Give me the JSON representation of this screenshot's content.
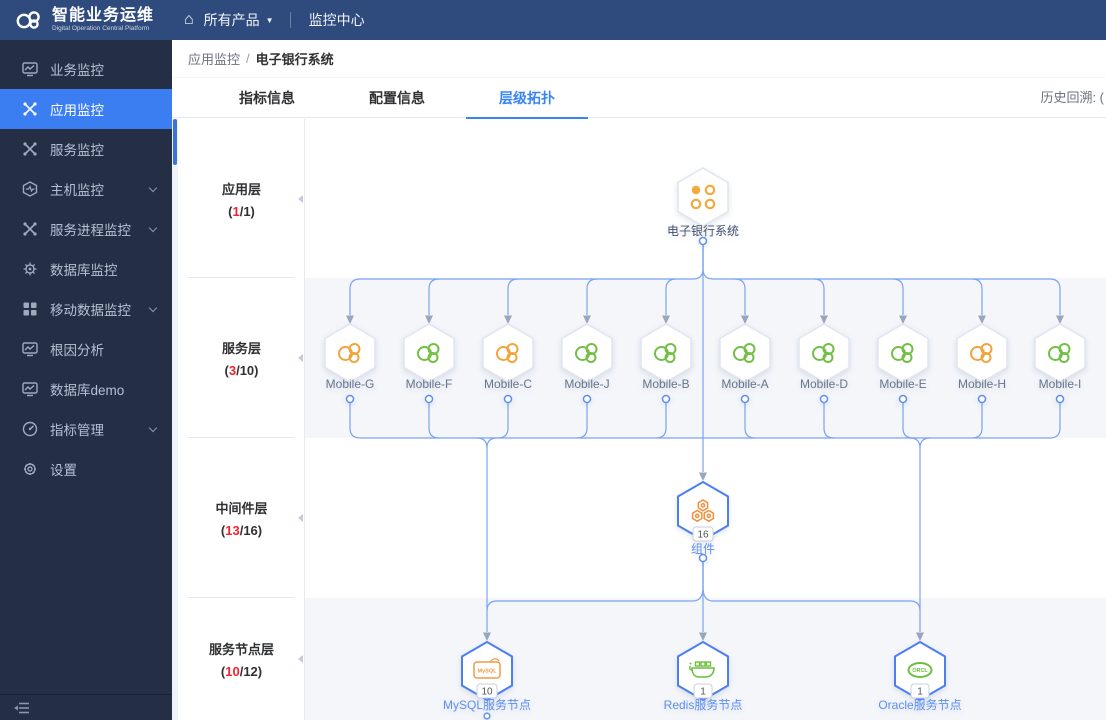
{
  "nav": {
    "title": "智能业务运维",
    "subtitle": "Digital Operation Central Platform",
    "home_glyph": "⌂",
    "product_menu": "所有产品",
    "caret": "▼",
    "center_menu": "监控中心"
  },
  "sidebar": {
    "items": [
      {
        "label": "业务监控",
        "active": false,
        "expandable": false
      },
      {
        "label": "应用监控",
        "active": true,
        "expandable": false
      },
      {
        "label": "服务监控",
        "active": false,
        "expandable": false
      },
      {
        "label": "主机监控",
        "active": false,
        "expandable": true
      },
      {
        "label": "服务进程监控",
        "active": false,
        "expandable": true
      },
      {
        "label": "数据库监控",
        "active": false,
        "expandable": false
      },
      {
        "label": "移动数据监控",
        "active": false,
        "expandable": true
      },
      {
        "label": "根因分析",
        "active": false,
        "expandable": false
      },
      {
        "label": "数据库demo",
        "active": false,
        "expandable": false
      },
      {
        "label": "指标管理",
        "active": false,
        "expandable": true
      },
      {
        "label": "设置",
        "active": false,
        "expandable": false
      }
    ]
  },
  "breadcrumb": {
    "parent": "应用监控",
    "separator": "/",
    "current": "电子银行系统"
  },
  "tabs": [
    {
      "label": "指标信息",
      "active": false
    },
    {
      "label": "配置信息",
      "active": false
    },
    {
      "label": "层级拓扑",
      "active": true
    }
  ],
  "toolbar": {
    "history_label": "历史回溯: ("
  },
  "fmt": {
    "open": "(",
    "slash": "/",
    "close": ")"
  },
  "layers": [
    {
      "name": "应用层",
      "current": "1",
      "total": "1"
    },
    {
      "name": "服务层",
      "current": "3",
      "total": "10"
    },
    {
      "name": "中间件层",
      "current": "13",
      "total": "16"
    },
    {
      "name": "服务节点层",
      "current": "10",
      "total": "12"
    }
  ],
  "topology": {
    "root": {
      "label": "电子银行系统"
    },
    "service_nodes": [
      {
        "label": "Mobile-G",
        "color": "#f0a43c"
      },
      {
        "label": "Mobile-F",
        "color": "#72bf44"
      },
      {
        "label": "Mobile-C",
        "color": "#f0a43c"
      },
      {
        "label": "Mobile-J",
        "color": "#72bf44"
      },
      {
        "label": "Mobile-B",
        "color": "#72bf44"
      },
      {
        "label": "Mobile-A",
        "color": "#72bf44"
      },
      {
        "label": "Mobile-D",
        "color": "#72bf44"
      },
      {
        "label": "Mobile-E",
        "color": "#72bf44"
      },
      {
        "label": "Mobile-H",
        "color": "#f0a43c"
      },
      {
        "label": "Mobile-I",
        "color": "#72bf44"
      }
    ],
    "middleware": {
      "label": "组件",
      "badge": "16"
    },
    "db_nodes": [
      {
        "label": "MySQL服务节点",
        "badge": "10",
        "icon_text": "MySQL"
      },
      {
        "label": "Redis服务节点",
        "badge": "1",
        "icon_text": ""
      },
      {
        "label": "Oracle服务节点",
        "badge": "1",
        "icon_text": "ORCL"
      }
    ],
    "colors": {
      "edge": "#7ba3f2",
      "arrow": "#98a6bd",
      "node_border": "#e1e5ed",
      "active_border": "#4d7ef2",
      "label_blue": "#5b8ff2",
      "status_warning": "#f0a43c",
      "status_ok": "#72bf44"
    }
  }
}
